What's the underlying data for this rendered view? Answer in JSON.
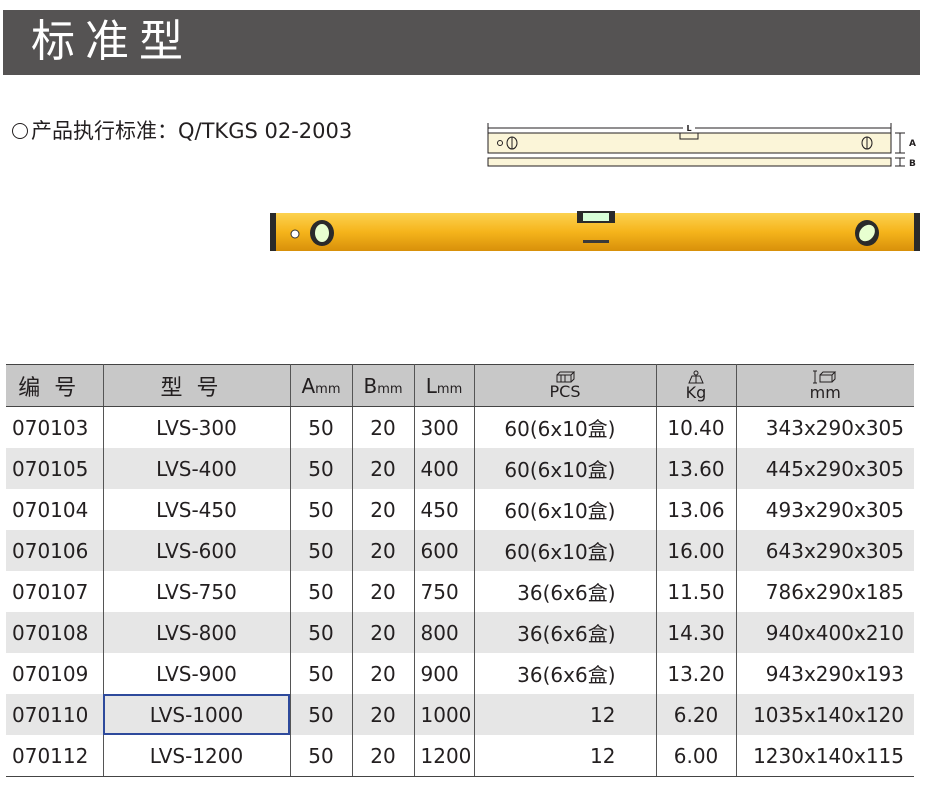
{
  "header": {
    "title": "标准型"
  },
  "standard": {
    "text": "产品执行标准：Q/TKGS 02-2003"
  },
  "diagram": {
    "label_length": "L",
    "label_height": "A",
    "label_width": "B"
  },
  "colors": {
    "title_bar": "#555353",
    "level_body": "#f5b41b",
    "header_bg": "#c8c8c8",
    "alt_row_bg": "#e6e6e6",
    "selection": "#2e4a9c"
  },
  "table": {
    "headers": {
      "code": "编号",
      "model": "型号",
      "a_main": "A",
      "a_unit": "mm",
      "b_main": "B",
      "b_unit": "mm",
      "l_main": "L",
      "l_unit": "mm",
      "pcs": "PCS",
      "kg": "Kg",
      "mm": "mm"
    },
    "rows": [
      {
        "code": "070103",
        "model": "LVS-300",
        "a": "50",
        "b": "20",
        "l": "300",
        "pcs": "60(6x10盒)",
        "kg": "10.40",
        "size": "343x290x305"
      },
      {
        "code": "070105",
        "model": "LVS-400",
        "a": "50",
        "b": "20",
        "l": "400",
        "pcs": "60(6x10盒)",
        "kg": "13.60",
        "size": "445x290x305"
      },
      {
        "code": "070104",
        "model": "LVS-450",
        "a": "50",
        "b": "20",
        "l": "450",
        "pcs": "60(6x10盒)",
        "kg": "13.06",
        "size": "493x290x305"
      },
      {
        "code": "070106",
        "model": "LVS-600",
        "a": "50",
        "b": "20",
        "l": "600",
        "pcs": "60(6x10盒)",
        "kg": "16.00",
        "size": "643x290x305"
      },
      {
        "code": "070107",
        "model": "LVS-750",
        "a": "50",
        "b": "20",
        "l": "750",
        "pcs": "36(6x6盒)",
        "kg": "11.50",
        "size": "786x290x185"
      },
      {
        "code": "070108",
        "model": "LVS-800",
        "a": "50",
        "b": "20",
        "l": "800",
        "pcs": "36(6x6盒)",
        "kg": "14.30",
        "size": "940x400x210"
      },
      {
        "code": "070109",
        "model": "LVS-900",
        "a": "50",
        "b": "20",
        "l": "900",
        "pcs": "36(6x6盒)",
        "kg": "13.20",
        "size": "943x290x193"
      },
      {
        "code": "070110",
        "model": "LVS-1000",
        "a": "50",
        "b": "20",
        "l": "1000",
        "pcs": "12",
        "kg": "6.20",
        "size": "1035x140x120"
      },
      {
        "code": "070112",
        "model": "LVS-1200",
        "a": "50",
        "b": "20",
        "l": "1200",
        "pcs": "12",
        "kg": "6.00",
        "size": "1230x140x115"
      }
    ]
  }
}
